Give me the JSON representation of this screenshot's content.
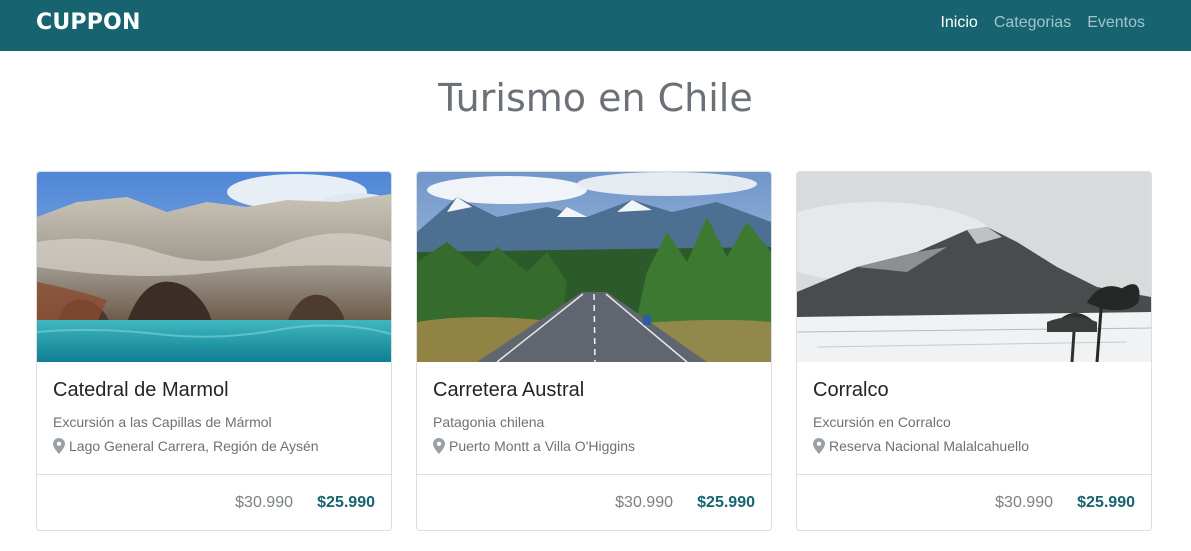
{
  "brand": "CUPPON",
  "nav": {
    "items": [
      {
        "label": "Inicio",
        "active": true
      },
      {
        "label": "Categorias",
        "active": false
      },
      {
        "label": "Eventos",
        "active": false
      }
    ]
  },
  "page_title": "Turismo en Chile",
  "cards": [
    {
      "title": "Catedral de Marmol",
      "subtitle": "Excursión a las Capillas de Mármol",
      "location": "Lago General Carrera, Región de Aysén",
      "old_price": "$30.990",
      "new_price": "$25.990",
      "image": "marble-caves-photo"
    },
    {
      "title": "Carretera Austral",
      "subtitle": "Patagonia chilena",
      "location": "Puerto Montt a Villa O'Higgins",
      "old_price": "$30.990",
      "new_price": "$25.990",
      "image": "mountain-road-photo"
    },
    {
      "title": "Corralco",
      "subtitle": "Excursión en Corralco",
      "location": "Reserva Nacional Malalcahuello",
      "old_price": "$30.990",
      "new_price": "$25.990",
      "image": "snowy-volcano-photo"
    }
  ],
  "colors": {
    "navbar": "#17636f",
    "accent_price": "#17636f",
    "title_gray": "#6b7177"
  }
}
